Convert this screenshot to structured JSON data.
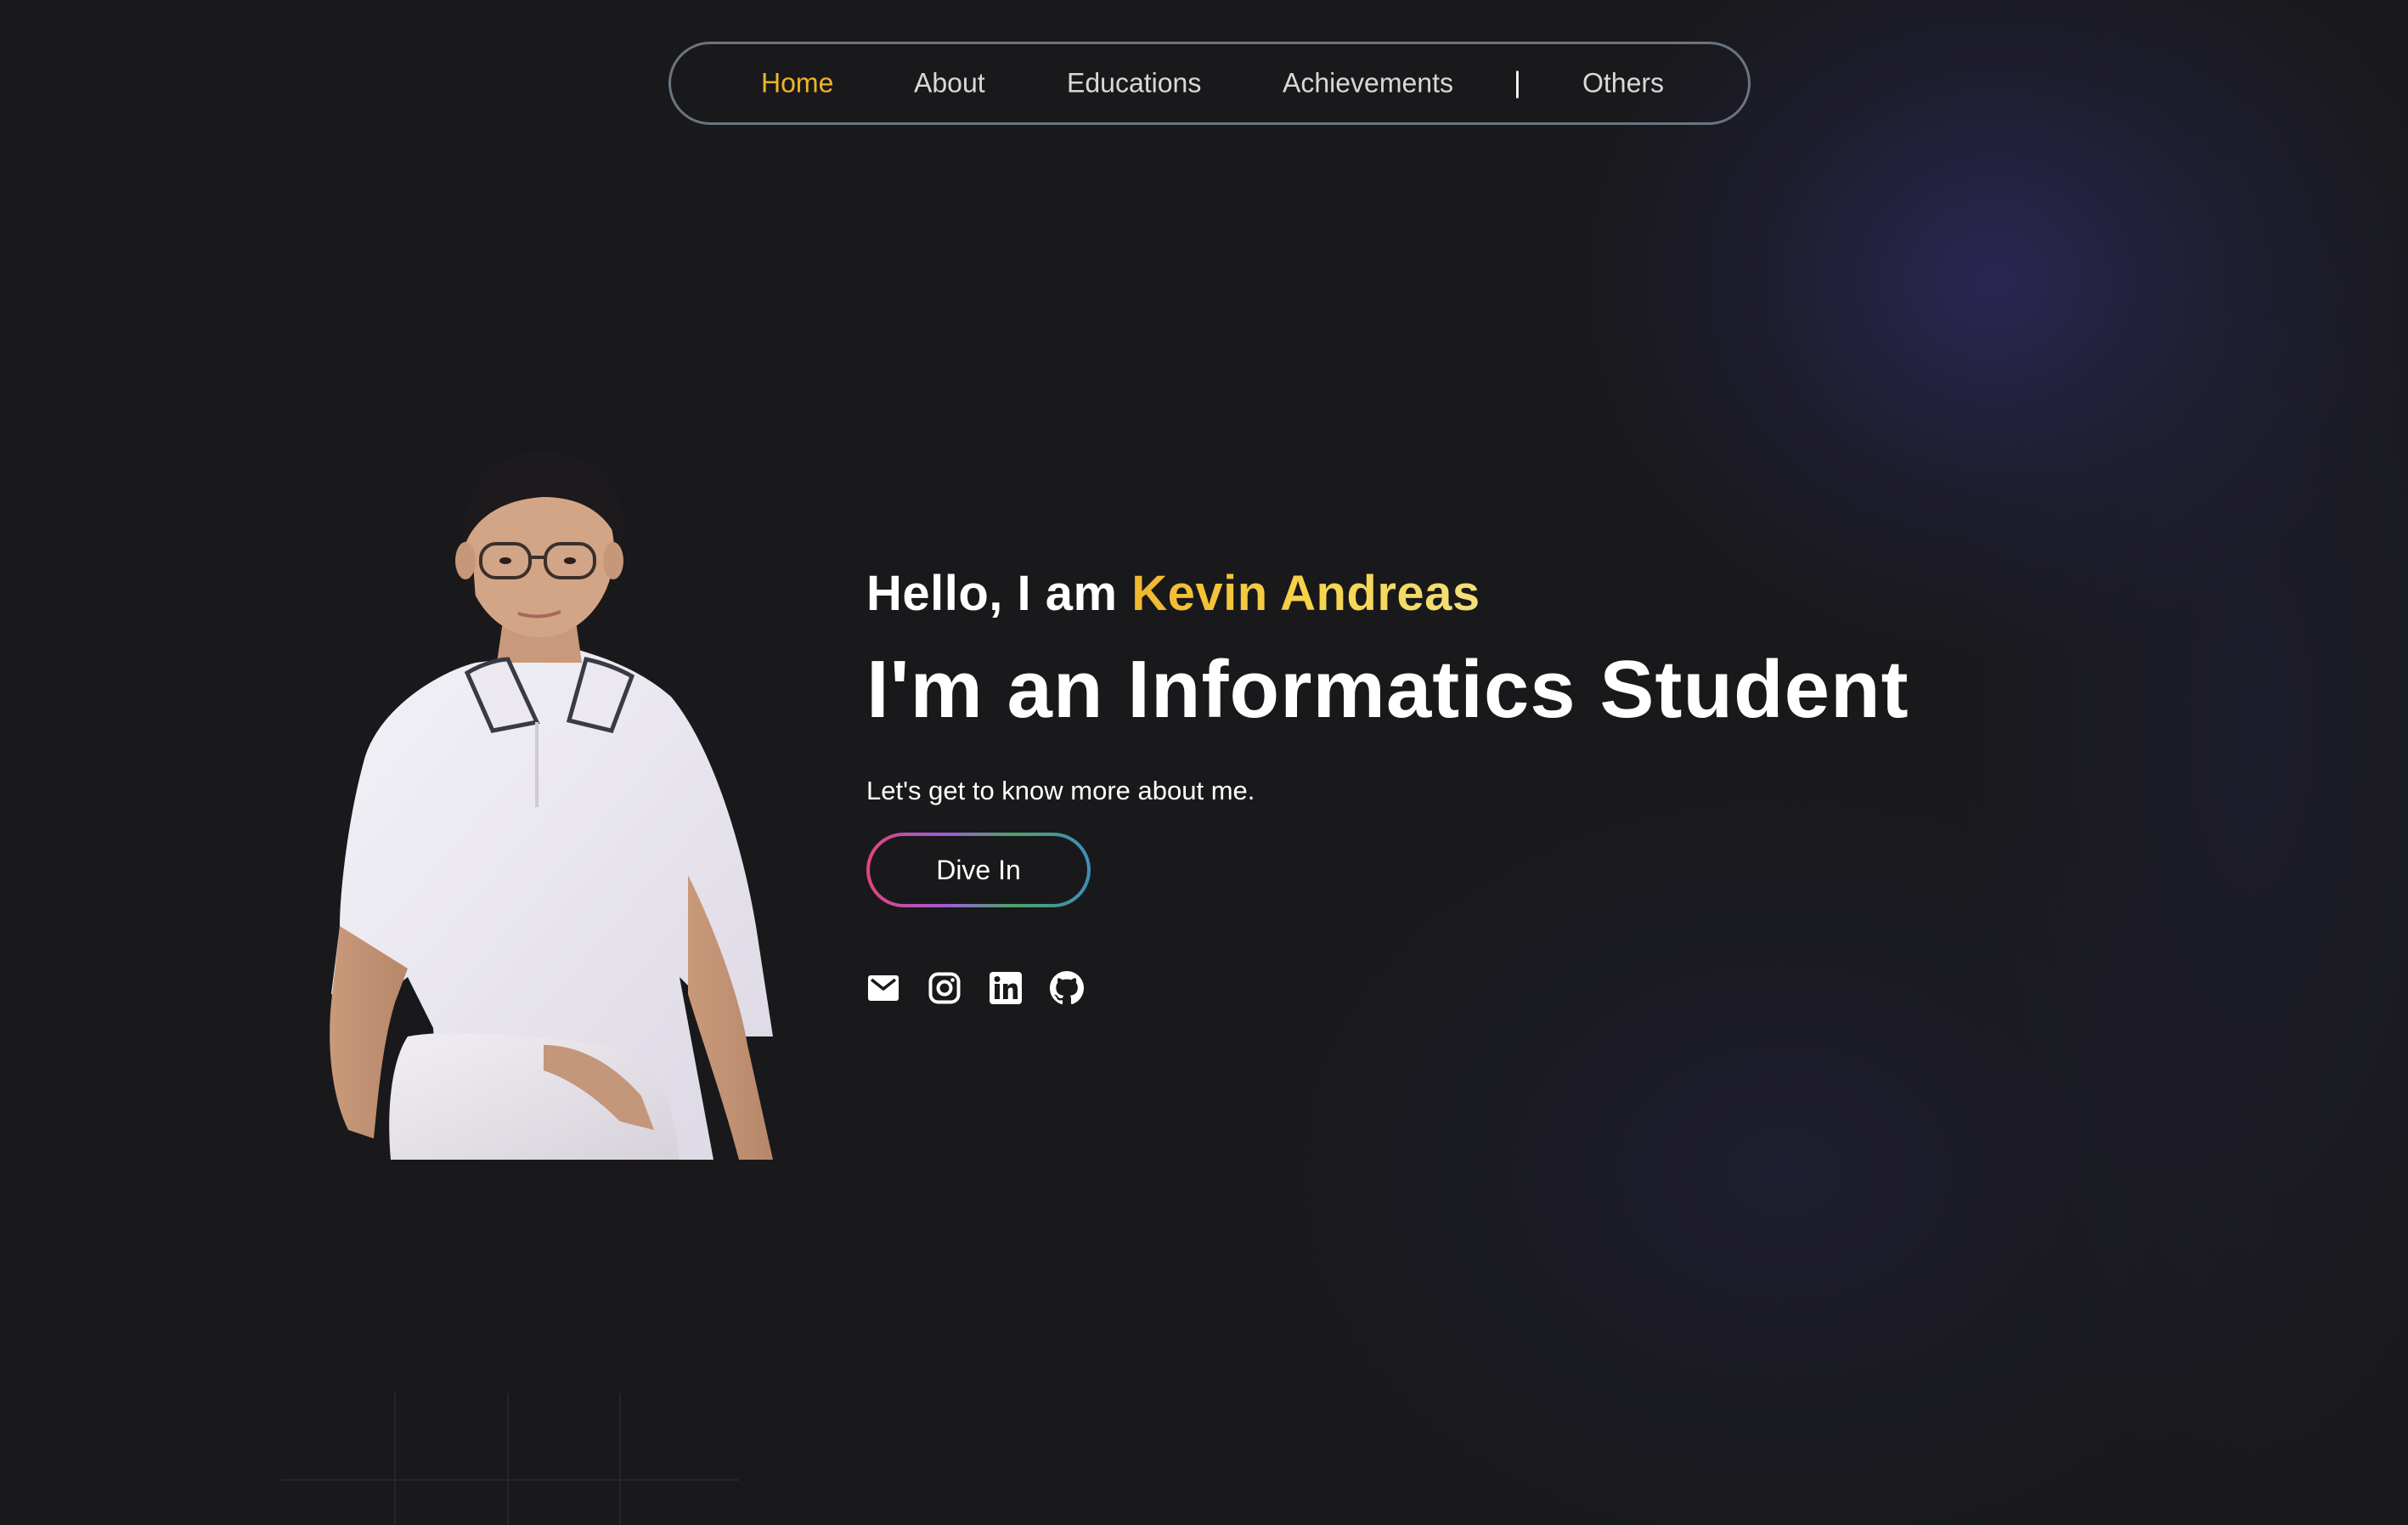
{
  "nav": {
    "items": [
      {
        "label": "Home",
        "active": true
      },
      {
        "label": "About",
        "active": false
      },
      {
        "label": "Educations",
        "active": false
      },
      {
        "label": "Achievements",
        "active": false
      },
      {
        "label": "Others",
        "active": false
      }
    ],
    "separator": "|",
    "active_color": "#f0b429"
  },
  "hero": {
    "greeting_prefix": "Hello, I am ",
    "name": "Kevin Andreas",
    "role": "I'm an Informatics Student",
    "tagline": "Let's get to know more about me.",
    "cta_label": "Dive In"
  },
  "socials": [
    {
      "icon": "mail-icon"
    },
    {
      "icon": "instagram-icon"
    },
    {
      "icon": "linkedin-icon"
    },
    {
      "icon": "github-icon"
    }
  ],
  "colors": {
    "background": "#19191b",
    "accent_gold": "#f0b72e",
    "text": "#ffffff"
  }
}
